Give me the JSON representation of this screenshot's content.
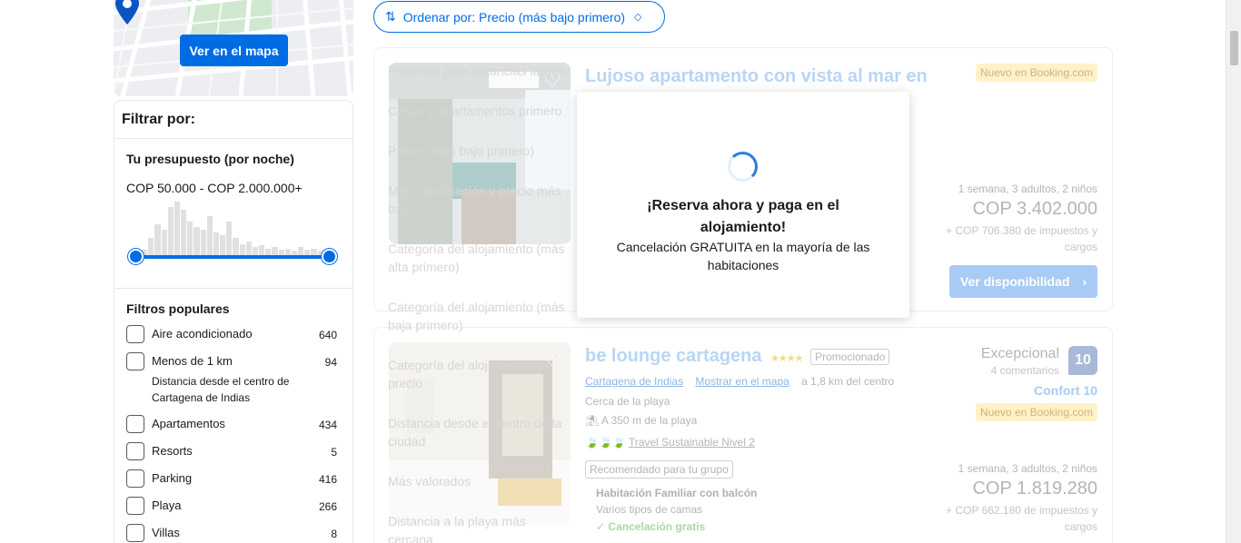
{
  "map": {
    "button_label": "Ver en el mapa"
  },
  "filters": {
    "header": "Filtrar por:",
    "budget": {
      "title": "Tu presupuesto (por noche)",
      "range": "COP 50.000 - COP 2.000.000+"
    },
    "popular": {
      "title": "Filtros populares",
      "items": [
        {
          "label": "Aire acondicionado",
          "count": "640"
        },
        {
          "label": "Menos de 1 km",
          "sub": "Distancia desde el centro de Cartagena de Indias",
          "count": "94"
        },
        {
          "label": "Apartamentos",
          "count": "434"
        },
        {
          "label": "Resorts",
          "count": "5"
        },
        {
          "label": "Parking",
          "count": "416"
        },
        {
          "label": "Playa",
          "count": "266"
        },
        {
          "label": "Villas",
          "count": "8"
        }
      ]
    }
  },
  "sort": {
    "label": "Ordenar por: Precio (más bajo primero)",
    "options": [
      "Favoritos para estancias largas",
      "Casas y apartamentos primero",
      "Precio (más bajo primero)",
      "Mejor puntuación y precio más bajo",
      "Categoría del alojamiento (más alta primero)",
      "Categoría del alojamiento (más baja primero)",
      "Categoría del alojamiento y precio",
      "Distancia desde el centro de la ciudad",
      "Más valorados",
      "Distancia a la playa más cercana"
    ]
  },
  "listings": [
    {
      "title": "Lujoso apartamento con vista al mar en",
      "badge": "Nuevo en Booking.com",
      "stay": "1 semana, 3 adultos, 2 niños",
      "price": "COP 3.402.000",
      "taxes": "+ COP 706.380 de impuestos y cargos",
      "cta": "Ver disponibilidad"
    },
    {
      "title": "be lounge cartagena",
      "stars": "★★★★",
      "promo": "Promocionado",
      "city_link": "Cartagena de Indias",
      "map_link": "Mostrar en el mapa",
      "distance": "a 1,8 km del centro",
      "near_beach": "Cerca de la playa",
      "beach_distance": "A 350 m de la playa",
      "sustainable": "Travel Sustainable Nivel 2",
      "recommended": "Recomendado para tu grupo",
      "room_name": "Habitación Familiar con balcón",
      "bed_types": "Varios tipos de camas",
      "free_cancel": "Cancelación gratis",
      "score_label": "Excepcional",
      "score_reviews": "4 comentarios",
      "score": "10",
      "comfort": "Confort 10",
      "badge": "Nuevo en Booking.com",
      "stay": "1 semana, 3 adultos, 2 niños",
      "price": "COP 1.819.280",
      "taxes": "+ COP 662.180 de impuestos y cargos"
    }
  ],
  "modal": {
    "title": "¡Reserva ahora y paga en el alojamiento!",
    "text": "Cancelación GRATUITA en la mayoría de las habitaciones"
  },
  "colors": {
    "brand_blue": "#006ce4",
    "badge_yellow": "#fff2c9"
  }
}
